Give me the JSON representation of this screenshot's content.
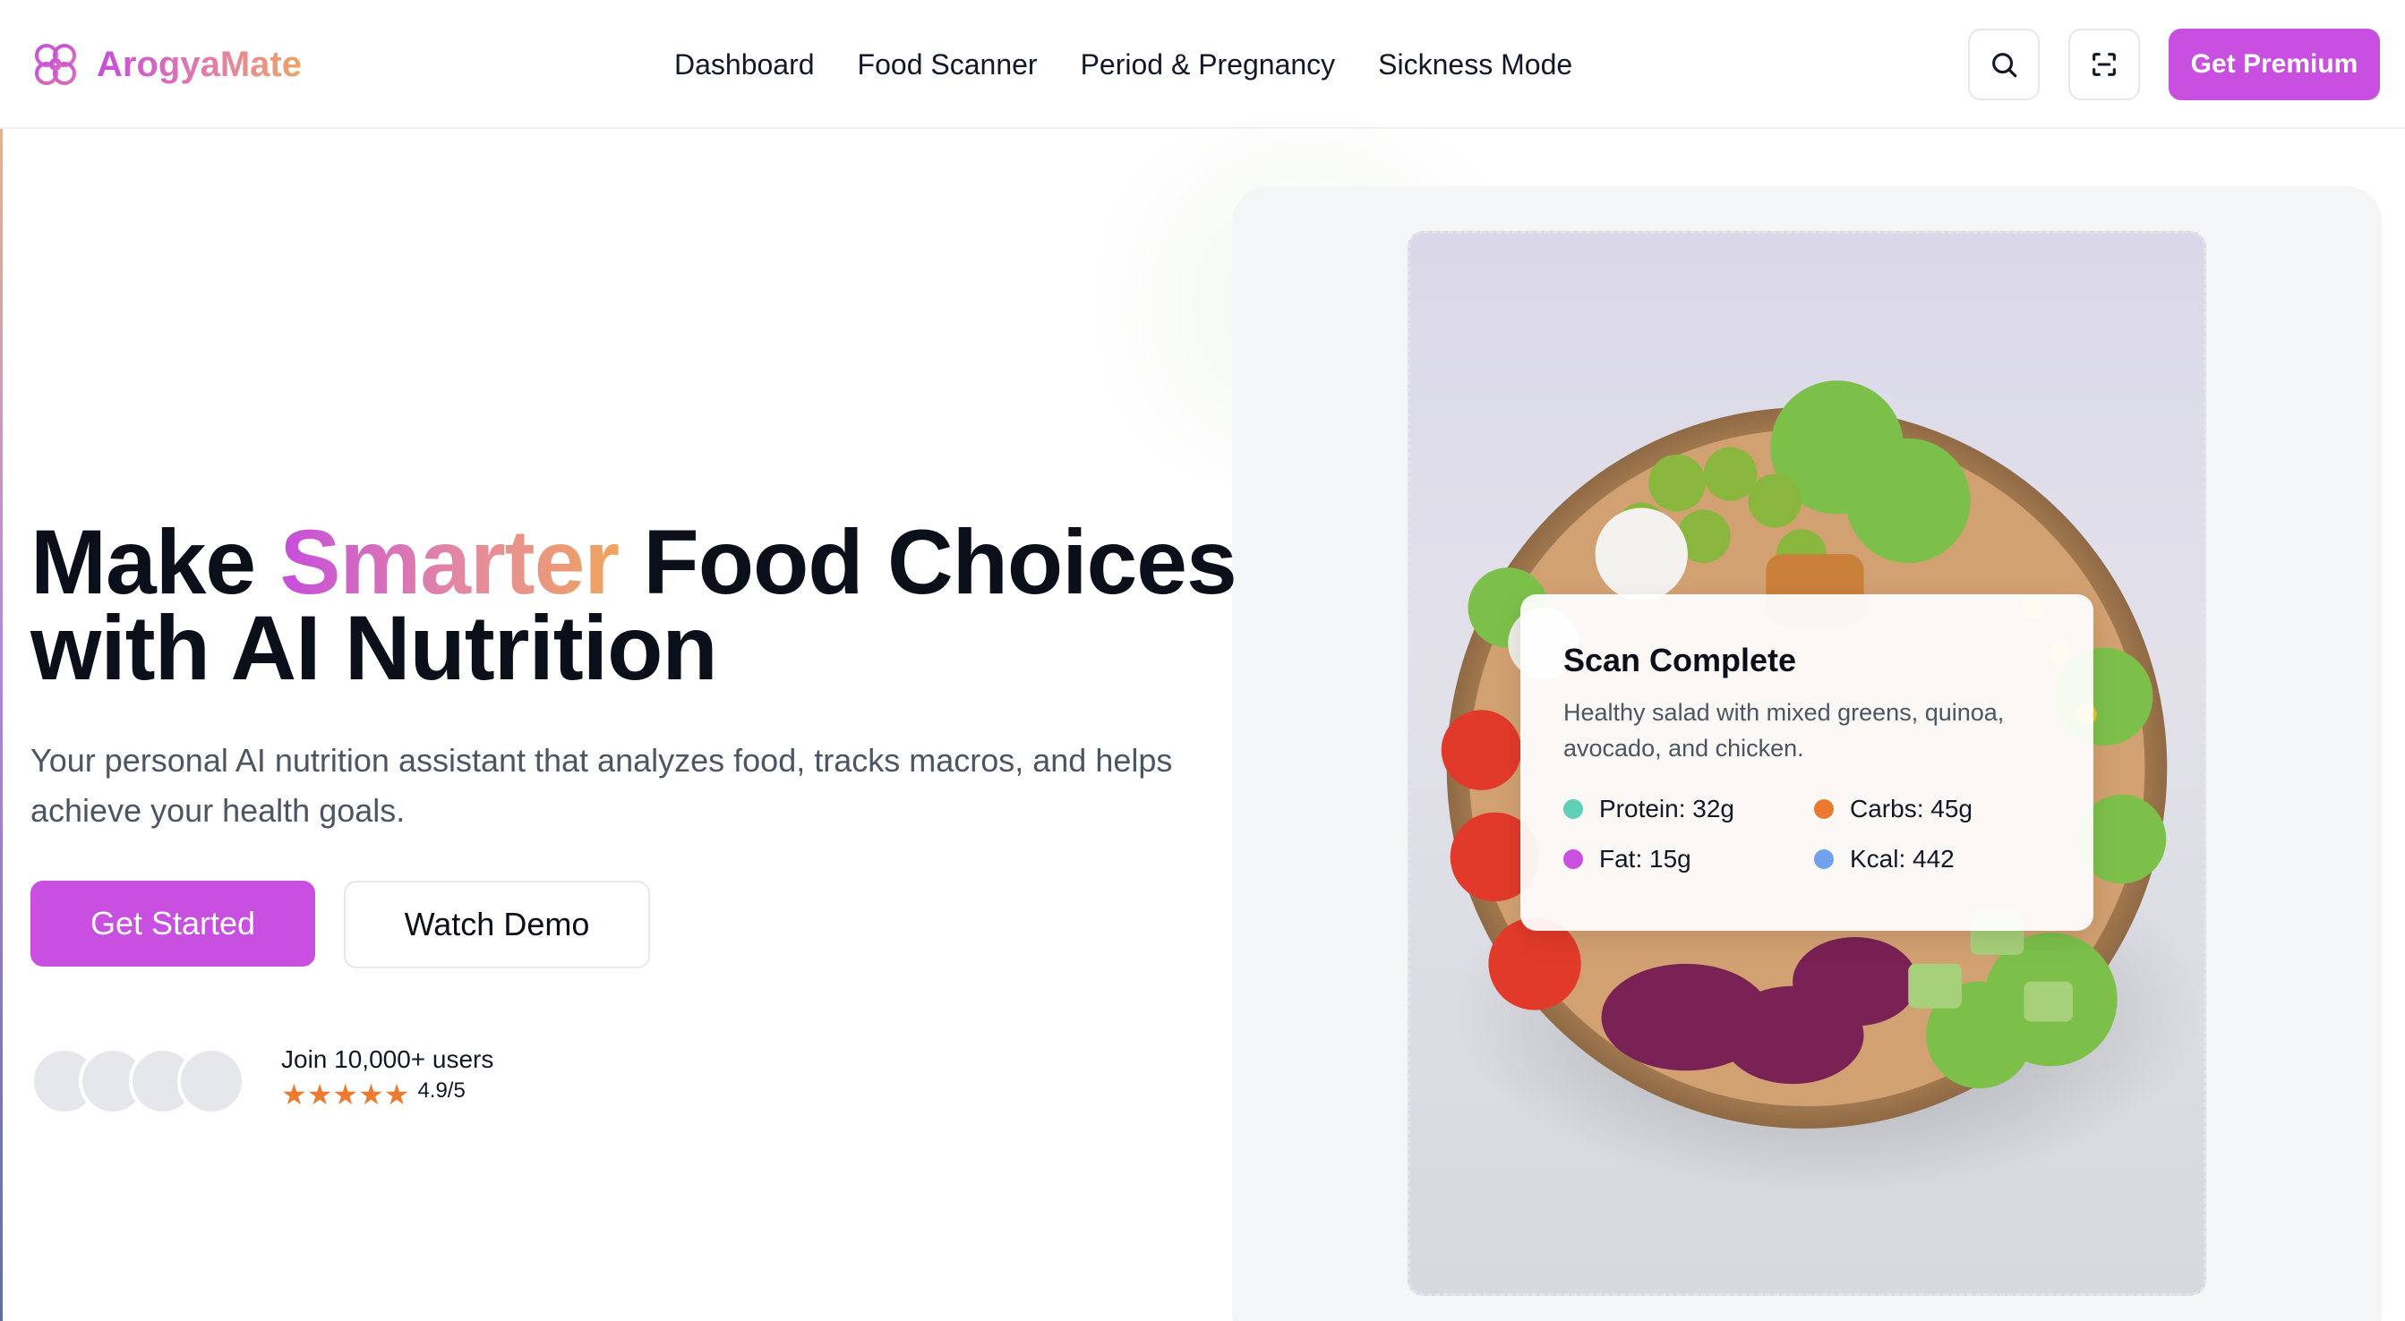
{
  "brand": {
    "name": "ArogyaMate"
  },
  "nav": {
    "items": [
      "Dashboard",
      "Food Scanner",
      "Period & Pregnancy",
      "Sickness Mode"
    ]
  },
  "header": {
    "premium_label": "Get Premium",
    "icons": [
      "search-icon",
      "scan-icon"
    ]
  },
  "hero": {
    "title_before": "Make ",
    "title_accent": "Smarter",
    "title_after": " Food Choices",
    "title_line2": "with AI Nutrition",
    "subtitle": "Your personal AI nutrition assistant that analyzes food, tracks macros, and helps achieve your health goals.",
    "primary_label": "Get Started",
    "secondary_label": "Watch Demo",
    "join_text": "Join 10,000+ users",
    "stars": "★★★★★",
    "rating": "4.9/5"
  },
  "scan": {
    "title": "Scan Complete",
    "description": "Healthy salad with mixed greens, quinoa, avocado, and chicken.",
    "macros": [
      {
        "label": "Protein: 32g",
        "color": "#5fcfb7"
      },
      {
        "label": "Carbs: 45g",
        "color": "#ea7a2e"
      },
      {
        "label": "Fat: 15g",
        "color": "#c950e0"
      },
      {
        "label": "Kcal: 442",
        "color": "#6fa1ee"
      }
    ]
  },
  "colors": {
    "accent": "#c84fe0",
    "gradient_end": "#f0a45e",
    "star": "#ec7a31"
  }
}
